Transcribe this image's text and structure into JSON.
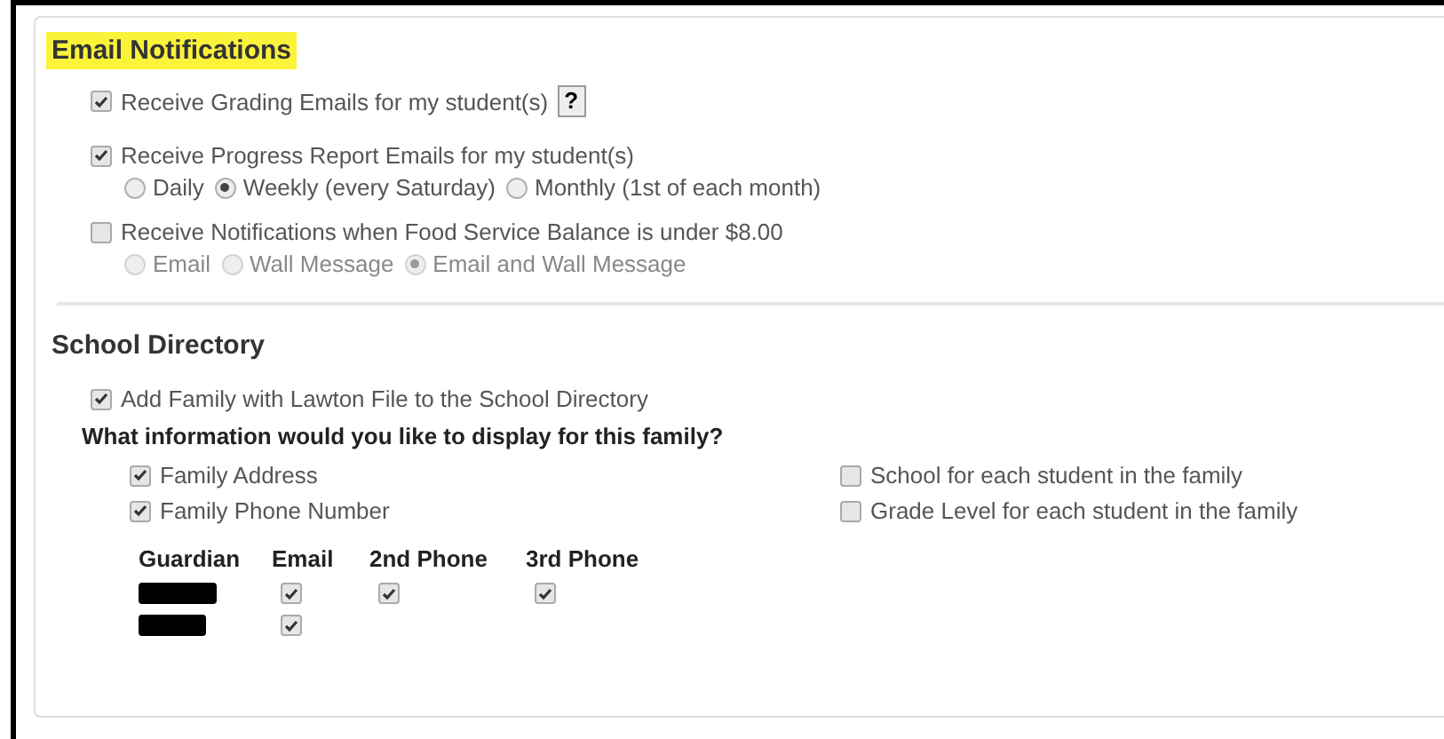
{
  "email_notifications": {
    "title": "Email Notifications",
    "highlighted": true,
    "options": [
      {
        "label": "Receive Grading Emails for my student(s)",
        "checked": true,
        "help": "?"
      },
      {
        "label": "Receive Progress Report Emails for my student(s)",
        "checked": true,
        "choices_disabled": false,
        "choices": [
          {
            "label": "Daily",
            "selected": false
          },
          {
            "label": "Weekly (every Saturday)",
            "selected": true
          },
          {
            "label": "Monthly (1st of each month)",
            "selected": false
          }
        ]
      },
      {
        "label": "Receive Notifications when Food Service Balance is under $8.00",
        "checked": false,
        "choices_disabled": true,
        "choices": [
          {
            "label": "Email",
            "selected": false
          },
          {
            "label": "Wall Message",
            "selected": false
          },
          {
            "label": "Email and Wall Message",
            "selected": true
          }
        ]
      }
    ]
  },
  "school_directory": {
    "title": "School Directory",
    "add_family": {
      "label": "Add Family with Lawton File to the School Directory",
      "checked": true
    },
    "question": "What information would you like to display for this family?",
    "left_options": [
      {
        "label": "Family Address",
        "checked": true
      },
      {
        "label": "Family Phone Number",
        "checked": true
      }
    ],
    "right_options": [
      {
        "label": "School for each student in the family",
        "checked": false
      },
      {
        "label": "Grade Level for each student in the family",
        "checked": false
      }
    ],
    "guardian_table": {
      "columns": [
        "Guardian",
        "Email",
        "2nd Phone",
        "3rd Phone"
      ],
      "rows": [
        {
          "redacted": true,
          "checks": [
            true,
            true,
            true
          ]
        },
        {
          "redacted": true,
          "checks": [
            true
          ]
        }
      ]
    }
  }
}
